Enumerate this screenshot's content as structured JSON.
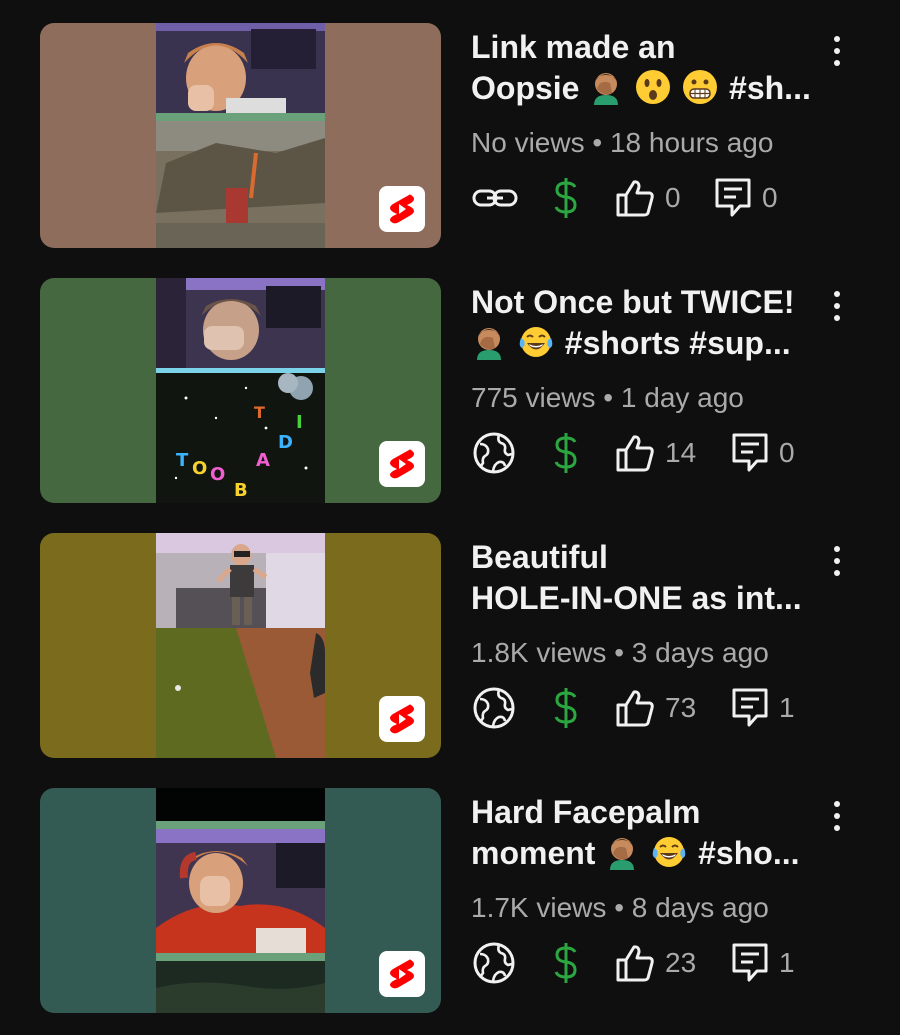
{
  "colors": {
    "background": "#0f0f0f",
    "title_text": "#f1f1f1",
    "meta_text": "#aaaaaa",
    "monetization_green": "#2ba640",
    "shorts_red": "#ff0000"
  },
  "videos": [
    {
      "title_line1": "Link made an",
      "title_line2": "Oopsie",
      "title_line2_suffix": "#sh...",
      "emojis": [
        "facepalm-emoji",
        "astonished-emoji",
        "grimace-emoji"
      ],
      "views": "No views",
      "separator": "•",
      "age": "18 hours ago",
      "visibility_icon": "link-icon",
      "likes": "0",
      "comments": "0",
      "thumb_bg": "#8e6d5c"
    },
    {
      "title_line1": "Not Once but TWICE!",
      "title_line2": "",
      "title_line2_suffix": "#shorts #sup...",
      "emojis": [
        "facepalm-emoji",
        "tears-of-joy-emoji"
      ],
      "views": "775 views",
      "separator": "•",
      "age": "1 day ago",
      "visibility_icon": "globe-icon",
      "likes": "14",
      "comments": "0",
      "thumb_bg": "#466840"
    },
    {
      "title_line1": "Beautiful",
      "title_line2": "HOLE-IN-ONE as int...",
      "title_line2_suffix": "",
      "emojis": [],
      "views": "1.8K views",
      "separator": "•",
      "age": "3 days ago",
      "visibility_icon": "globe-icon",
      "likes": "73",
      "comments": "1",
      "thumb_bg": "#7a6c1c"
    },
    {
      "title_line1": "Hard Facepalm",
      "title_line2": "moment",
      "title_line2_suffix": "#sho...",
      "emojis": [
        "facepalm-emoji",
        "tears-of-joy-emoji"
      ],
      "views": "1.7K views",
      "separator": "•",
      "age": "8 days ago",
      "visibility_icon": "globe-icon",
      "likes": "23",
      "comments": "1",
      "thumb_bg": "#345a54"
    }
  ]
}
